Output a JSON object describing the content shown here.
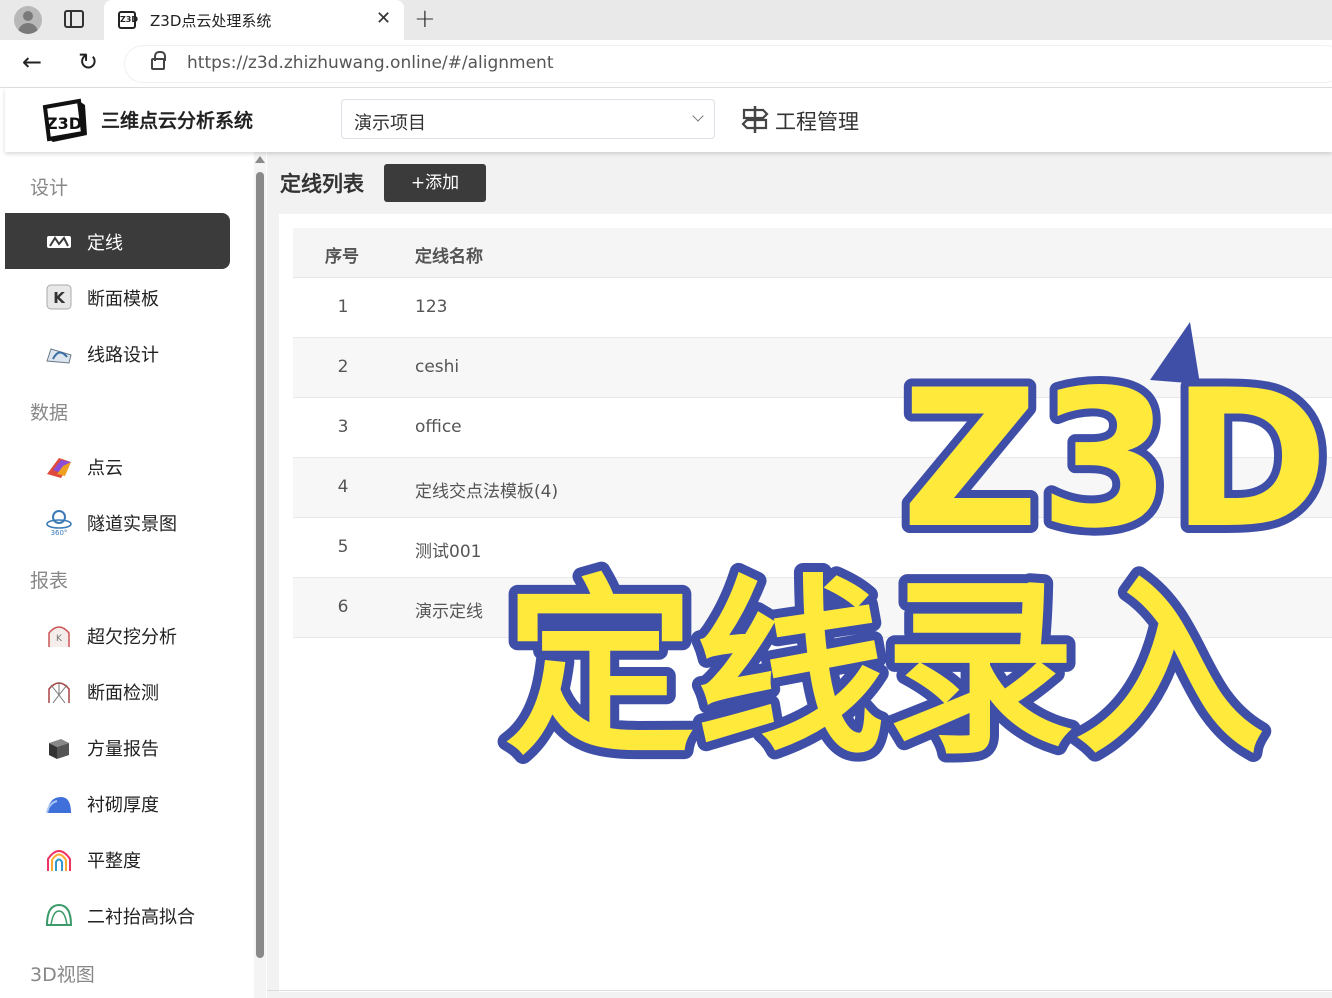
{
  "browser": {
    "tab_title": "Z3D点云处理系统",
    "favicon_text": "Z3D",
    "close_glyph": "✕",
    "newtab_glyph": "+",
    "back_glyph": "←",
    "reload_glyph": "↻",
    "url": "https://z3d.zhizhuwang.online/#/alignment"
  },
  "header": {
    "logo_text": "Z3D",
    "app_title": "三维点云分析系统",
    "project_select": "演示项目",
    "engineering_mgmt": "工程管理"
  },
  "sidebar": {
    "sections": [
      {
        "title": "设计",
        "items": [
          "定线",
          "断面模板",
          "线路设计"
        ]
      },
      {
        "title": "数据",
        "items": [
          "点云",
          "隧道实景图"
        ]
      },
      {
        "title": "报表",
        "items": [
          "超欠挖分析",
          "断面检测",
          "方量报告",
          "衬砌厚度",
          "平整度",
          "二衬抬高拟合"
        ]
      },
      {
        "title": "3D视图",
        "items": []
      }
    ],
    "active_item": "定线",
    "icons": {
      "定线": "alignment-icon",
      "断面模板": "section-template-icon",
      "线路设计": "route-design-icon",
      "点云": "point-cloud-icon",
      "隧道实景图": "panorama-360-icon",
      "超欠挖分析": "overbreak-icon",
      "断面检测": "section-check-icon",
      "方量报告": "volume-report-icon",
      "衬砌厚度": "lining-thickness-icon",
      "平整度": "flatness-icon",
      "二衬抬高拟合": "secondary-lining-icon"
    }
  },
  "main": {
    "title": "定线列表",
    "add_button": "+添加",
    "columns": [
      "序号",
      "定线名称"
    ],
    "rows": [
      {
        "idx": "1",
        "name": "123"
      },
      {
        "idx": "2",
        "name": "ceshi"
      },
      {
        "idx": "3",
        "name": "office"
      },
      {
        "idx": "4",
        "name": "定线交点法模板(4)"
      },
      {
        "idx": "5",
        "name": "测试001"
      },
      {
        "idx": "6",
        "name": "演示定线"
      }
    ]
  },
  "overlay": {
    "big_logo": "Z3D",
    "big_caption": "定线录入"
  },
  "colors": {
    "active_menu": "#3b3b3b",
    "overlay_fill": "#ffe93b",
    "overlay_stroke": "#3f4fa8"
  }
}
